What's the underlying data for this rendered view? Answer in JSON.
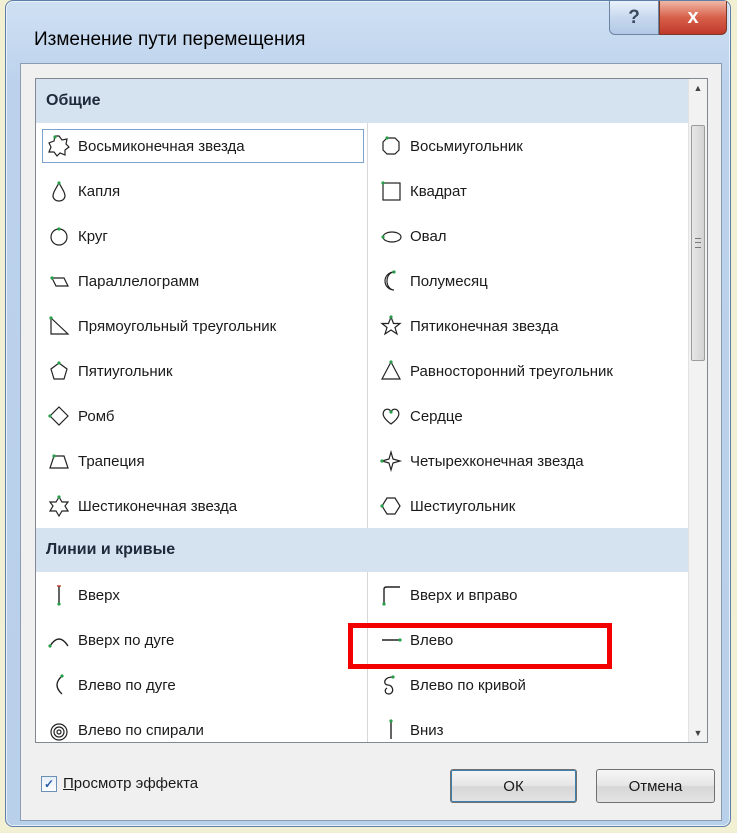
{
  "window": {
    "title": "Изменение пути перемещения",
    "help_label": "?",
    "close_label": "x"
  },
  "sections": [
    {
      "header": "Общие",
      "items_left": [
        {
          "label": "Восьмиконечная звезда",
          "icon": "eight-point-star-icon",
          "selected": true
        },
        {
          "label": "Капля",
          "icon": "teardrop-icon"
        },
        {
          "label": "Круг",
          "icon": "circle-icon"
        },
        {
          "label": "Параллелограмм",
          "icon": "parallelogram-icon"
        },
        {
          "label": "Прямоугольный треугольник",
          "icon": "right-triangle-icon"
        },
        {
          "label": "Пятиугольник",
          "icon": "pentagon-icon"
        },
        {
          "label": "Ромб",
          "icon": "diamond-icon"
        },
        {
          "label": "Трапеция",
          "icon": "trapezoid-icon"
        },
        {
          "label": "Шестиконечная звезда",
          "icon": "six-point-star-icon"
        }
      ],
      "items_right": [
        {
          "label": "Восьмиугольник",
          "icon": "octagon-icon"
        },
        {
          "label": "Квадрат",
          "icon": "square-icon"
        },
        {
          "label": "Овал",
          "icon": "oval-icon"
        },
        {
          "label": "Полумесяц",
          "icon": "crescent-icon"
        },
        {
          "label": "Пятиконечная звезда",
          "icon": "five-point-star-icon"
        },
        {
          "label": "Равносторонний треугольник",
          "icon": "equilateral-triangle-icon"
        },
        {
          "label": "Сердце",
          "icon": "heart-icon"
        },
        {
          "label": "Четырехконечная звезда",
          "icon": "four-point-star-icon"
        },
        {
          "label": "Шестиугольник",
          "icon": "hexagon-icon"
        }
      ]
    },
    {
      "header": "Линии и кривые",
      "items_left": [
        {
          "label": "Вверх",
          "icon": "line-up-icon"
        },
        {
          "label": "Вверх по дуге",
          "icon": "arc-up-icon"
        },
        {
          "label": "Влево по дуге",
          "icon": "arc-left-icon"
        },
        {
          "label": "Влево по спирали",
          "icon": "spiral-left-icon"
        }
      ],
      "items_right": [
        {
          "label": "Вверх и вправо",
          "icon": "up-right-icon"
        },
        {
          "label": "Влево",
          "icon": "line-left-icon"
        },
        {
          "label": "Влево по кривой",
          "icon": "curvy-left-icon"
        },
        {
          "label": "Вниз",
          "icon": "line-down-icon"
        }
      ]
    }
  ],
  "preview": {
    "checked": true,
    "label_prefix": "П",
    "label_rest": "росмотр эффекта"
  },
  "buttons": {
    "ok": "ОК",
    "cancel": "Отмена"
  },
  "colors": {
    "highlight": "#f20000",
    "section_header_bg": "#d5e3f1"
  }
}
